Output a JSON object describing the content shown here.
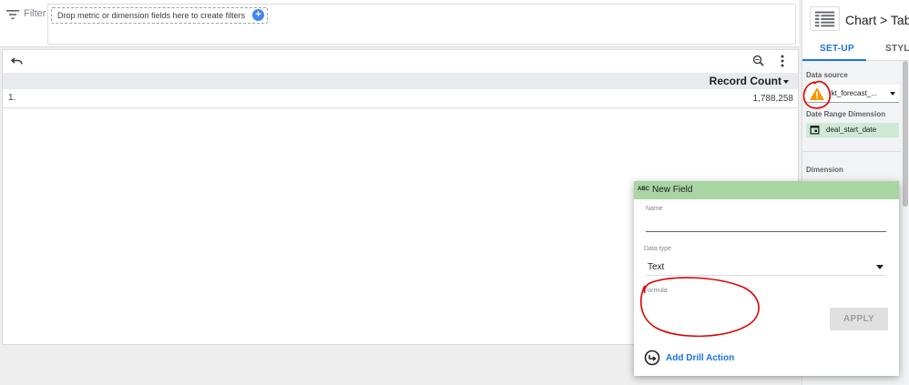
{
  "filter_bar": {
    "label": "Filter",
    "drop_hint": "Drop metric or dimension fields here to create filters",
    "add_icon": "plus-circle-icon"
  },
  "table": {
    "column_header": "Record Count",
    "rows": [
      {
        "index": "1.",
        "value": "1,788,258"
      }
    ]
  },
  "right_panel": {
    "breadcrumb": "Chart > Tabl",
    "tabs": {
      "setup": "SET-UP",
      "style": "STYLE"
    },
    "data_source_label": "Data source",
    "data_source_value": "rkt_forecast_...",
    "date_range_label": "Date Range Dimension",
    "date_range_value": "deal_start_date",
    "dimension_label": "Dimension"
  },
  "new_field": {
    "title": "New Field",
    "type_badge": "ABC",
    "name_label": "Name",
    "name_value": "",
    "data_type_label": "Data type",
    "data_type_value": "Text",
    "formula_label": "Formula",
    "formula_value": "",
    "apply_label": "APPLY",
    "drill_action_label": "Add Drill Action"
  },
  "colors": {
    "accent_blue": "#1a73e8",
    "header_green": "#a8d5a2",
    "chip_green": "#ceead6",
    "warning_orange": "#f29900",
    "annotation_red": "#e00000"
  }
}
